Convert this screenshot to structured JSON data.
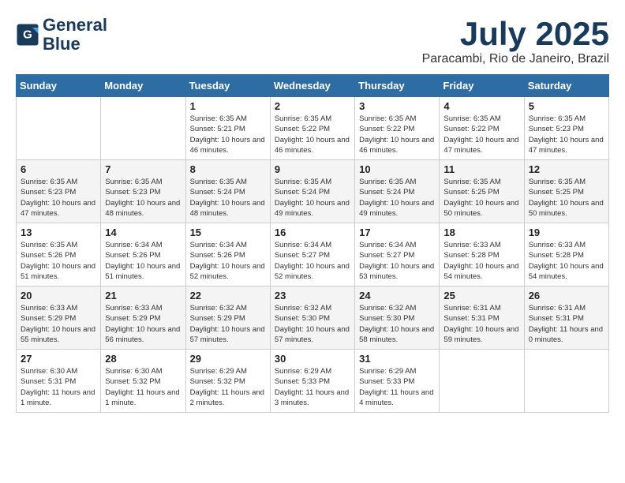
{
  "header": {
    "logo_line1": "General",
    "logo_line2": "Blue",
    "month_title": "July 2025",
    "location": "Paracambi, Rio de Janeiro, Brazil"
  },
  "weekdays": [
    "Sunday",
    "Monday",
    "Tuesday",
    "Wednesday",
    "Thursday",
    "Friday",
    "Saturday"
  ],
  "weeks": [
    [
      {
        "day": "",
        "info": ""
      },
      {
        "day": "",
        "info": ""
      },
      {
        "day": "1",
        "info": "Sunrise: 6:35 AM\nSunset: 5:21 PM\nDaylight: 10 hours and 46 minutes."
      },
      {
        "day": "2",
        "info": "Sunrise: 6:35 AM\nSunset: 5:22 PM\nDaylight: 10 hours and 46 minutes."
      },
      {
        "day": "3",
        "info": "Sunrise: 6:35 AM\nSunset: 5:22 PM\nDaylight: 10 hours and 46 minutes."
      },
      {
        "day": "4",
        "info": "Sunrise: 6:35 AM\nSunset: 5:22 PM\nDaylight: 10 hours and 47 minutes."
      },
      {
        "day": "5",
        "info": "Sunrise: 6:35 AM\nSunset: 5:23 PM\nDaylight: 10 hours and 47 minutes."
      }
    ],
    [
      {
        "day": "6",
        "info": "Sunrise: 6:35 AM\nSunset: 5:23 PM\nDaylight: 10 hours and 47 minutes."
      },
      {
        "day": "7",
        "info": "Sunrise: 6:35 AM\nSunset: 5:23 PM\nDaylight: 10 hours and 48 minutes."
      },
      {
        "day": "8",
        "info": "Sunrise: 6:35 AM\nSunset: 5:24 PM\nDaylight: 10 hours and 48 minutes."
      },
      {
        "day": "9",
        "info": "Sunrise: 6:35 AM\nSunset: 5:24 PM\nDaylight: 10 hours and 49 minutes."
      },
      {
        "day": "10",
        "info": "Sunrise: 6:35 AM\nSunset: 5:24 PM\nDaylight: 10 hours and 49 minutes."
      },
      {
        "day": "11",
        "info": "Sunrise: 6:35 AM\nSunset: 5:25 PM\nDaylight: 10 hours and 50 minutes."
      },
      {
        "day": "12",
        "info": "Sunrise: 6:35 AM\nSunset: 5:25 PM\nDaylight: 10 hours and 50 minutes."
      }
    ],
    [
      {
        "day": "13",
        "info": "Sunrise: 6:35 AM\nSunset: 5:26 PM\nDaylight: 10 hours and 51 minutes."
      },
      {
        "day": "14",
        "info": "Sunrise: 6:34 AM\nSunset: 5:26 PM\nDaylight: 10 hours and 51 minutes."
      },
      {
        "day": "15",
        "info": "Sunrise: 6:34 AM\nSunset: 5:26 PM\nDaylight: 10 hours and 52 minutes."
      },
      {
        "day": "16",
        "info": "Sunrise: 6:34 AM\nSunset: 5:27 PM\nDaylight: 10 hours and 52 minutes."
      },
      {
        "day": "17",
        "info": "Sunrise: 6:34 AM\nSunset: 5:27 PM\nDaylight: 10 hours and 53 minutes."
      },
      {
        "day": "18",
        "info": "Sunrise: 6:33 AM\nSunset: 5:28 PM\nDaylight: 10 hours and 54 minutes."
      },
      {
        "day": "19",
        "info": "Sunrise: 6:33 AM\nSunset: 5:28 PM\nDaylight: 10 hours and 54 minutes."
      }
    ],
    [
      {
        "day": "20",
        "info": "Sunrise: 6:33 AM\nSunset: 5:29 PM\nDaylight: 10 hours and 55 minutes."
      },
      {
        "day": "21",
        "info": "Sunrise: 6:33 AM\nSunset: 5:29 PM\nDaylight: 10 hours and 56 minutes."
      },
      {
        "day": "22",
        "info": "Sunrise: 6:32 AM\nSunset: 5:29 PM\nDaylight: 10 hours and 57 minutes."
      },
      {
        "day": "23",
        "info": "Sunrise: 6:32 AM\nSunset: 5:30 PM\nDaylight: 10 hours and 57 minutes."
      },
      {
        "day": "24",
        "info": "Sunrise: 6:32 AM\nSunset: 5:30 PM\nDaylight: 10 hours and 58 minutes."
      },
      {
        "day": "25",
        "info": "Sunrise: 6:31 AM\nSunset: 5:31 PM\nDaylight: 10 hours and 59 minutes."
      },
      {
        "day": "26",
        "info": "Sunrise: 6:31 AM\nSunset: 5:31 PM\nDaylight: 11 hours and 0 minutes."
      }
    ],
    [
      {
        "day": "27",
        "info": "Sunrise: 6:30 AM\nSunset: 5:31 PM\nDaylight: 11 hours and 1 minute."
      },
      {
        "day": "28",
        "info": "Sunrise: 6:30 AM\nSunset: 5:32 PM\nDaylight: 11 hours and 1 minute."
      },
      {
        "day": "29",
        "info": "Sunrise: 6:29 AM\nSunset: 5:32 PM\nDaylight: 11 hours and 2 minutes."
      },
      {
        "day": "30",
        "info": "Sunrise: 6:29 AM\nSunset: 5:33 PM\nDaylight: 11 hours and 3 minutes."
      },
      {
        "day": "31",
        "info": "Sunrise: 6:29 AM\nSunset: 5:33 PM\nDaylight: 11 hours and 4 minutes."
      },
      {
        "day": "",
        "info": ""
      },
      {
        "day": "",
        "info": ""
      }
    ]
  ]
}
